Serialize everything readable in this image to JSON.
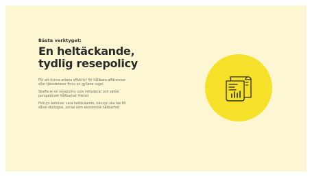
{
  "slide": {
    "eyebrow": "Bästa verktyget:",
    "headline_lines": [
      "En heltäckande,",
      "tydlig resepolicy"
    ],
    "paragraphs": [
      {
        "lines": [
          "För att kunna arbeta effektivt för hållbara affärsresor",
          "eller tjänsteresor finns en gyllene regel."
        ]
      },
      {
        "lines": [
          "Skaffa er en resepolicy som inkluderar och sätter",
          "perspektivet hållbarhet främst."
        ]
      },
      {
        "lines": [
          "Policyn behöver vara heltäckande, hänsyn ska tas till",
          "såväl ekologisk, social som ekonomisk hållbarhet."
        ]
      }
    ],
    "illustration": {
      "icon": "policy-document-scroll-icon",
      "circle_color": "#f7e02a",
      "background_color": "#fdf6d3"
    }
  }
}
